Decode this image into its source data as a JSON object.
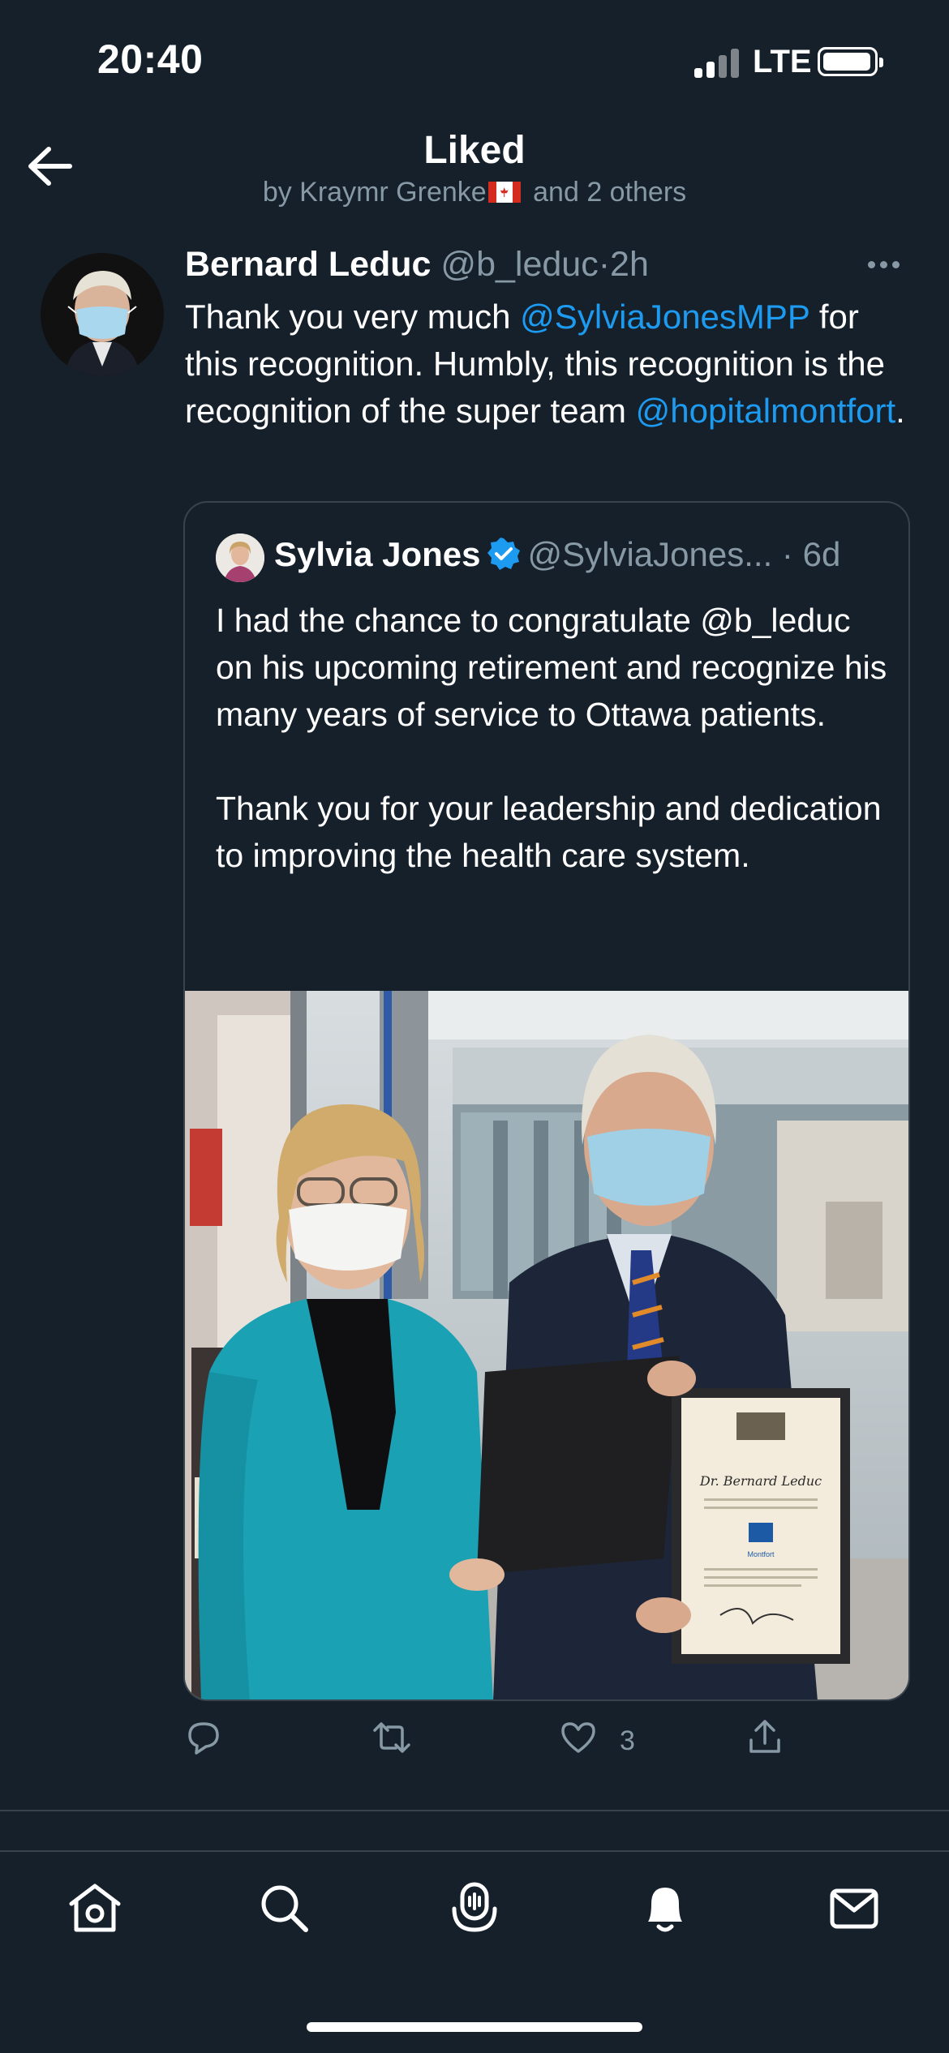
{
  "status_bar": {
    "time": "20:40",
    "network": "LTE"
  },
  "header": {
    "title": "Liked",
    "subtitle_prefix": "by Kraymr Grenke",
    "subtitle_suffix": "and 2 others"
  },
  "tweet": {
    "author_name": "Bernard Leduc",
    "author_handle": "@b_leduc",
    "separator": "·",
    "time": "2h",
    "text_1": "Thank you very much ",
    "mention_1": "@SylviaJonesMPP",
    "text_2": " for this recognition. Humbly, this recognition is the recognition of the super team ",
    "mention_2": "@hopitalmontfort",
    "text_3": "."
  },
  "quote": {
    "author_name": "Sylvia Jones",
    "author_handle": "@SylviaJones...",
    "separator": "·",
    "time": "6d",
    "text": "I had the chance to congratulate @b_leduc on his upcoming retirement and recognize his many years of service to Ottawa patients.\n\nThank you for your leadership and dedication to improving the health care system.",
    "certificate_name": "Dr. Bernard Leduc",
    "certificate_logo": "Montfort"
  },
  "actions": {
    "like_count": "3"
  },
  "colors": {
    "background": "#15202b",
    "accent": "#1d9bf0",
    "muted": "#8899a6",
    "border": "#38444d"
  },
  "icons": {
    "back": "arrow-left-icon",
    "reply": "reply-icon",
    "retweet": "retweet-icon",
    "like": "heart-icon",
    "share": "share-icon",
    "home": "home-icon",
    "search": "search-icon",
    "spaces": "spaces-icon",
    "notifications": "bell-icon",
    "messages": "mail-icon"
  }
}
